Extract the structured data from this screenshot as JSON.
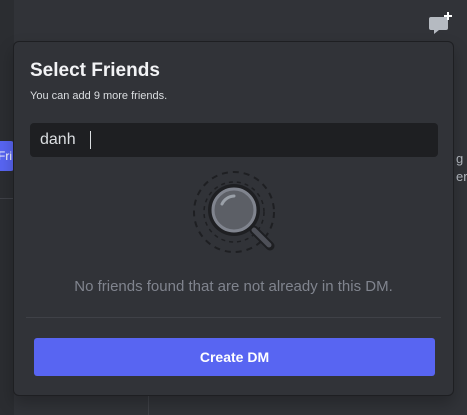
{
  "background": {
    "friends_tab_label": "Fri",
    "right_text": "g a\ner"
  },
  "dialog": {
    "title": "Select Friends",
    "subtitle": "You can add 9 more friends.",
    "search": {
      "value": "danh"
    },
    "empty_state": {
      "message": "No friends found that are not already in this DM."
    },
    "create_button_label": "Create DM"
  },
  "colors": {
    "accent": "#5865f2",
    "surface": "#313338",
    "input_bg": "#1e1f22",
    "muted_text": "#80848e"
  },
  "icons": {
    "new_dm": "new-group-dm-icon",
    "empty": "magnifier-empty-icon"
  }
}
